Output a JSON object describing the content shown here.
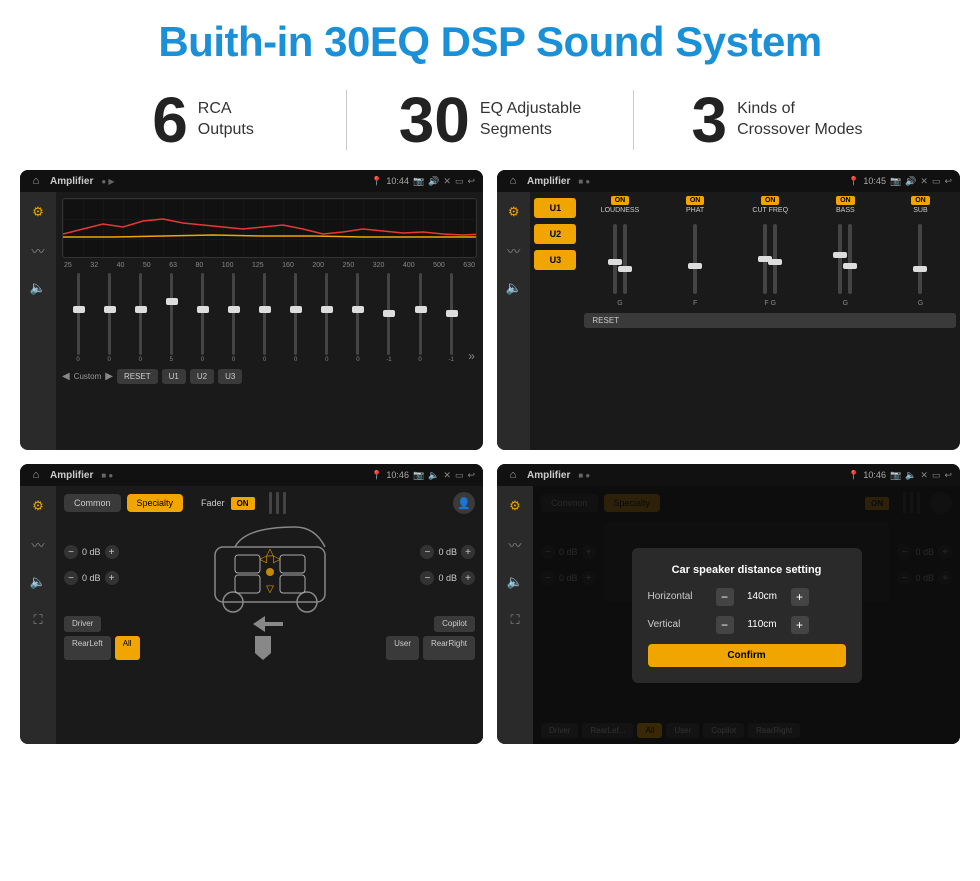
{
  "header": {
    "title": "Buith-in 30EQ DSP Sound System"
  },
  "stats": [
    {
      "number": "6",
      "line1": "RCA",
      "line2": "Outputs"
    },
    {
      "number": "30",
      "line1": "EQ Adjustable",
      "line2": "Segments"
    },
    {
      "number": "3",
      "line1": "Kinds of",
      "line2": "Crossover Modes"
    }
  ],
  "screens": {
    "eq": {
      "status_bar": {
        "app": "Amplifier",
        "time": "10:44"
      },
      "freq_labels": [
        "25",
        "32",
        "40",
        "50",
        "63",
        "80",
        "100",
        "125",
        "160",
        "200",
        "250",
        "320",
        "400",
        "500",
        "630"
      ],
      "slider_values": [
        "0",
        "0",
        "0",
        "5",
        "0",
        "0",
        "0",
        "0",
        "0",
        "0",
        "-1",
        "0",
        "-1"
      ],
      "bottom_btns": [
        "Custom",
        "RESET",
        "U1",
        "U2",
        "U3"
      ]
    },
    "crossover": {
      "status_bar": {
        "app": "Amplifier",
        "time": "10:45"
      },
      "u_buttons": [
        "U1",
        "U2",
        "U3"
      ],
      "controls": [
        {
          "label": "LOUDNESS",
          "on": true
        },
        {
          "label": "PHAT",
          "on": true
        },
        {
          "label": "CUT FREQ",
          "on": true
        },
        {
          "label": "BASS",
          "on": true
        },
        {
          "label": "SUB",
          "on": true
        }
      ]
    },
    "fader": {
      "status_bar": {
        "app": "Amplifier",
        "time": "10:46"
      },
      "tabs": [
        "Common",
        "Specialty"
      ],
      "fader_label": "Fader",
      "on": "ON",
      "db_values": [
        "0 dB",
        "0 dB",
        "0 dB",
        "0 dB"
      ],
      "bottom_btns": [
        "Driver",
        "RearLeft",
        "All",
        "User",
        "Copilot",
        "RearRight"
      ]
    },
    "distance": {
      "status_bar": {
        "app": "Amplifier",
        "time": "10:46"
      },
      "tabs": [
        "Common",
        "Specialty"
      ],
      "dialog": {
        "title": "Car speaker distance setting",
        "horizontal_label": "Horizontal",
        "horizontal_value": "140cm",
        "vertical_label": "Vertical",
        "vertical_value": "110cm",
        "confirm_label": "Confirm"
      },
      "db_right": [
        "0 dB",
        "0 dB"
      ],
      "bottom_btns": [
        "Driver",
        "RearLef...",
        "All",
        "User",
        "Copilot",
        "RearRight"
      ]
    }
  }
}
